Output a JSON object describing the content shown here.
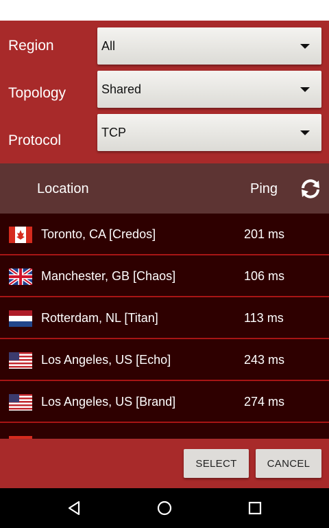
{
  "filters": {
    "region": {
      "label": "Region",
      "value": "All"
    },
    "topology": {
      "label": "Topology",
      "value": "Shared"
    },
    "protocol": {
      "label": "Protocol",
      "value": "TCP"
    }
  },
  "list_header": {
    "location": "Location",
    "ping": "Ping",
    "refresh_icon": "refresh-icon"
  },
  "servers": [
    {
      "location": "Toronto, CA [Credos]",
      "ping": "201 ms",
      "flag": "canada-flag-icon"
    },
    {
      "location": "Manchester, GB [Chaos]",
      "ping": "106 ms",
      "flag": "uk-flag-icon"
    },
    {
      "location": "Rotterdam, NL [Titan]",
      "ping": "113 ms",
      "flag": "netherlands-flag-icon"
    },
    {
      "location": "Los Angeles, US [Echo]",
      "ping": "243 ms",
      "flag": "us-flag-icon"
    },
    {
      "location": "Los Angeles, US [Brand]",
      "ping": "274 ms",
      "flag": "us-flag-icon"
    }
  ],
  "buttons": {
    "select": "SELECT",
    "cancel": "CANCEL"
  },
  "colors": {
    "panel": "#a82a2a",
    "list_bg": "#2e0000",
    "header_bg": "#5d3433",
    "divider": "#a81515"
  }
}
